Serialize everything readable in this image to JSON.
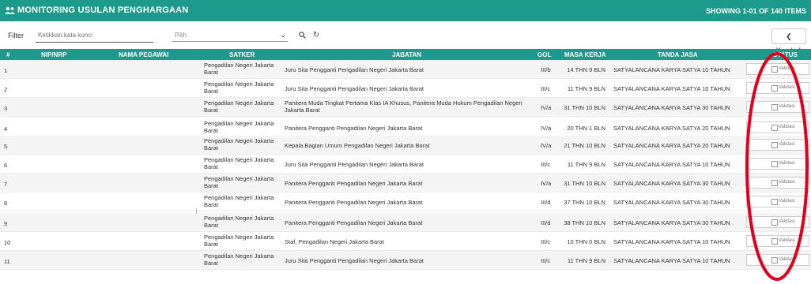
{
  "header": {
    "title": "MONITORING USULAN PENGHARGAAN",
    "count": "SHOWING 1-01 OF 140 ITEMS",
    "icon": "users-icon",
    "bg_color": "#1c9a8b"
  },
  "filter": {
    "label": "Filter",
    "search_placeholder": "Ketikkan kata kunci",
    "select_value": "Pilih",
    "search_icon": "search-icon",
    "refresh_icon": "refresh-icon",
    "back_label": "❮ Kembali"
  },
  "table": {
    "columns": [
      "#",
      "NIP/NRP",
      "NAMA PEGAWAI",
      "SATKER",
      "JABATAN",
      "GOL",
      "MASA KERJA",
      "TANDA JASA",
      "STATUS"
    ],
    "rows": [
      {
        "no": "1",
        "satker": "Pengadilan Negeri Jakarta Barat",
        "jabatan": "Juru Sita Pengganti Pengadilan Negeri Jakarta Barat",
        "gol": "III/b",
        "masa": "14 THN 9 BLN",
        "tanda": "SATYALANCANA KARYA SATYA 10 TAHUN",
        "status": "Validasi"
      },
      {
        "no": "2",
        "satker": "Pengadilan Negeri Jakarta Barat",
        "jabatan": "Juru Sita Pengganti Pengadilan Negeri Jakarta Barat",
        "gol": "III/c",
        "masa": "11 THN 9 BLN",
        "tanda": "SATYALANCANA KARYA SATYA 10 TAHUN",
        "status": "Validasi"
      },
      {
        "no": "3",
        "satker": "Pengadilan Negeri Jakarta Barat",
        "jabatan": "Panitera Muda Tingkat Pertama Klas IA Khusus, Panitera Muda Hukum Pengadilan Negeri Jakarta Barat",
        "gol": "IV/a",
        "masa": "31 THN 10 BLN",
        "tanda": "SATYALANCANA KARYA SATYA 30 TAHUN",
        "status": "Validasi"
      },
      {
        "no": "4",
        "satker": "Pengadilan Negeri Jakarta Barat",
        "jabatan": "Panitera Pengganti Pengadilan Negeri Jakarta Barat",
        "gol": "IV/a",
        "masa": "20 THN 1 BLN",
        "tanda": "SATYALANCANA KARYA SATYA 20 TAHUN",
        "status": "Validasi"
      },
      {
        "no": "5",
        "satker": "Pengadilan Negeri Jakarta Barat",
        "jabatan": "Kepala Bagian Umum Pengadilan Negeri Jakarta Barat",
        "gol": "IV/a",
        "masa": "21 THN 10 BLN",
        "tanda": "SATYALANCANA KARYA SATYA 20 TAHUN",
        "status": "Validasi"
      },
      {
        "no": "6",
        "satker": "Pengadilan Negeri Jakarta Barat",
        "jabatan": "Juru Sita Pengganti Pengadilan Negeri Jakarta Barat",
        "gol": "III/c",
        "masa": "11 THN 9 BLN",
        "tanda": "SATYALANCANA KARYA SATYA 10 TAHUN",
        "status": "Validasi"
      },
      {
        "no": "7",
        "satker": "Pengadilan Negeri Jakarta Barat",
        "jabatan": "Panitera Pengganti Pengadilan Negeri Jakarta Barat",
        "gol": "IV/a",
        "masa": "31 THN 10 BLN",
        "tanda": "SATYALANCANA KARYA SATYA 30 TAHUN",
        "status": "Validasi"
      },
      {
        "no": "8",
        "satker": "Pengadilan Negeri Jakarta Barat",
        "jabatan": "Panitera Pengganti Pengadilan Negeri Jakarta Barat",
        "gol": "III/d",
        "masa": "37 THN 10 BLN",
        "tanda": "SATYALANCANA KARYA SATYA 30 TAHUN",
        "status": "Validasi"
      },
      {
        "no": "9",
        "satker": "Pengadilan Negeri Jakarta Barat",
        "jabatan": "Panitera Pengganti Pengadilan Negeri Jakarta Barat",
        "gol": "III/d",
        "masa": "38 THN 10 BLN",
        "tanda": "SATYALANCANA KARYA SATYA 30 TAHUN",
        "status": "Validasi"
      },
      {
        "no": "10",
        "satker": "Pengadilan Negeri Jakarta Barat",
        "jabatan": "Staf, Pengadilan Negeri Jakarta Barat",
        "gol": "III/c",
        "masa": "10 THN 0 BLN",
        "tanda": "SATYALANCANA KARYA SATYA 10 TAHUN",
        "status": "Validasi"
      },
      {
        "no": "11",
        "satker": "Pengadilan Negeri Jakarta Barat",
        "jabatan": "Juru Sita Pengganti Pengadilan Negeri Jakarta Barat",
        "gol": "III/c",
        "masa": "11 THN 9 BLN",
        "tanda": "SATYALANCANA KARYA SATYA 10 TAHUN",
        "status": "Validasi"
      }
    ]
  },
  "annotation": {
    "color": "#e0001b",
    "shape": "ellipse"
  }
}
